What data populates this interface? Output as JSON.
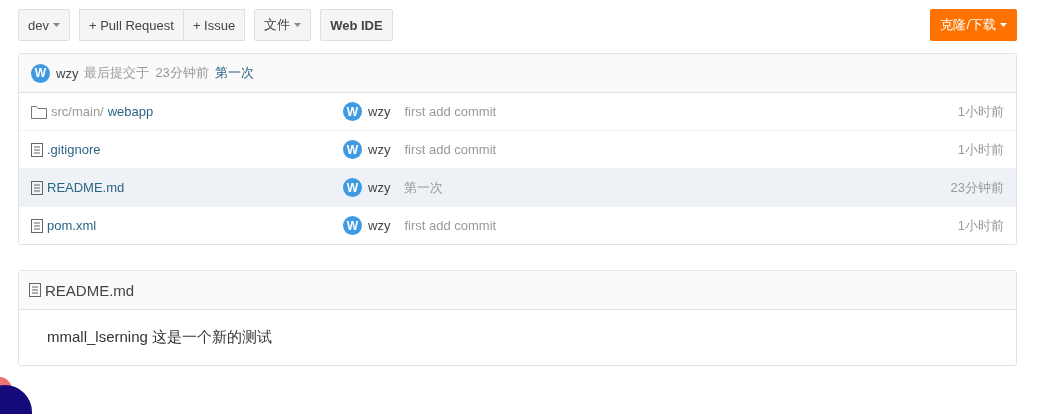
{
  "toolbar": {
    "branch": "dev",
    "group": [
      "+ Pull Request",
      "+ Issue"
    ],
    "file_menu": "文件",
    "web_ide": "Web IDE",
    "clone": "克隆/下载"
  },
  "last_commit": {
    "avatar": "W",
    "author": "wzy",
    "label": "最后提交于",
    "time": "23分钟前",
    "message": "第一次"
  },
  "files": [
    {
      "kind": "folder",
      "path": "src/main/",
      "name": "webapp",
      "avatar": "W",
      "author": "wzy",
      "message": "first add commit",
      "time": "1小时前",
      "selected": false
    },
    {
      "kind": "file",
      "name": ".gitignore",
      "avatar": "W",
      "author": "wzy",
      "message": "first add commit",
      "time": "1小时前",
      "selected": false
    },
    {
      "kind": "file",
      "name": "README.md",
      "avatar": "W",
      "author": "wzy",
      "message": "第一次",
      "time": "23分钟前",
      "selected": true
    },
    {
      "kind": "file",
      "name": "pom.xml",
      "avatar": "W",
      "author": "wzy",
      "message": "first add commit",
      "time": "1小时前",
      "selected": false
    }
  ],
  "readme": {
    "title": "README.md",
    "body": "mmall_lserning 这是一个新的测试"
  }
}
